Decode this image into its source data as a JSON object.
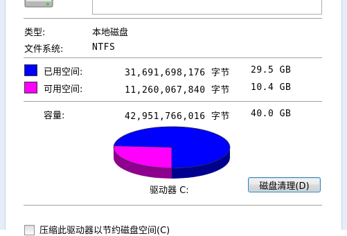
{
  "drive": {
    "type_label": "类型:",
    "type_value": "本地磁盘",
    "fs_label": "文件系统:",
    "fs_value": "NTFS"
  },
  "usage": {
    "used": {
      "label": "已用空间:",
      "bytes": "31,691,698,176 字节",
      "size": "29.5 GB",
      "color": "#0000ff"
    },
    "free": {
      "label": "可用空间:",
      "bytes": "11,260,067,840 字节",
      "size": "10.4 GB",
      "color": "#ff00ff"
    },
    "capacity": {
      "label": "容量:",
      "bytes": "42,951,766,016 字节",
      "size": "40.0 GB"
    },
    "used_fraction": 0.738
  },
  "drive_label": "驱动器 C:",
  "cleanup_button": "磁盘清理(D)",
  "compress_checkbox": "压缩此驱动器以节约磁盘空间(C)"
}
